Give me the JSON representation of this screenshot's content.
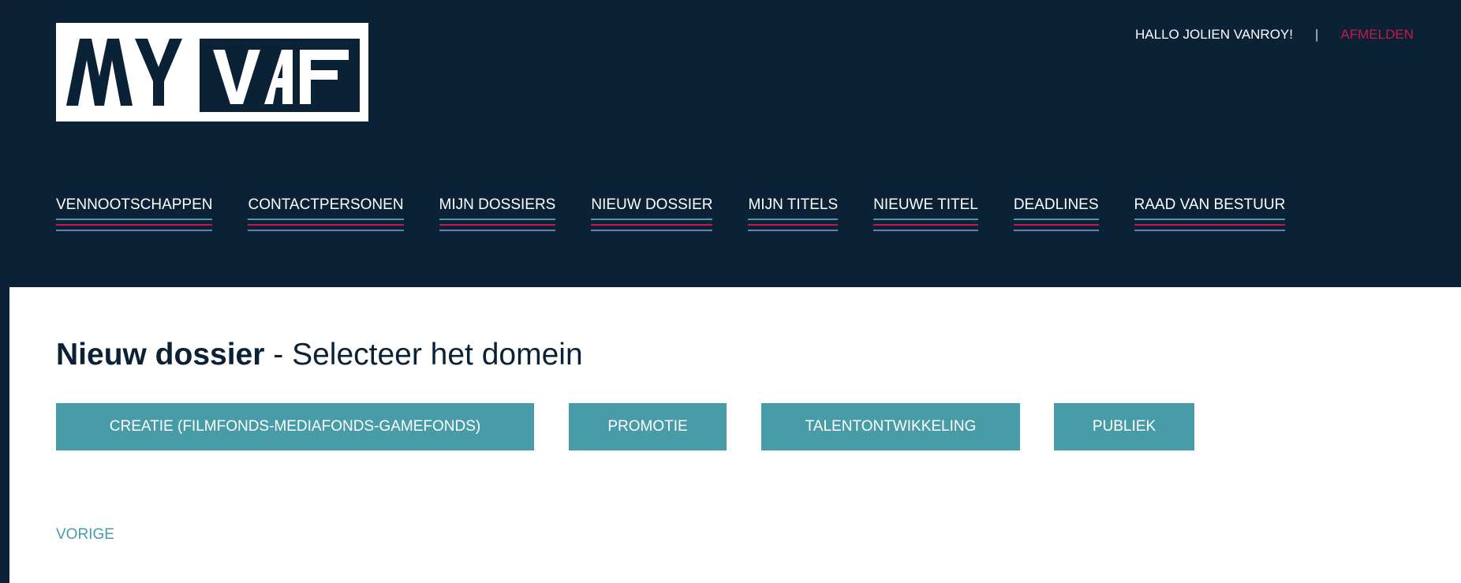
{
  "header": {
    "logo": {
      "text_left": "MY",
      "text_right": "VAF"
    },
    "user": {
      "greeting": "HALLO JOLIEN VANROY!",
      "separator": "|",
      "logout_label": "AFMELDEN"
    },
    "nav": {
      "items": [
        {
          "label": "VENNOOTSCHAPPEN"
        },
        {
          "label": "CONTACTPERSONEN"
        },
        {
          "label": "MIJN DOSSIERS"
        },
        {
          "label": "NIEUW DOSSIER"
        },
        {
          "label": "MIJN TITELS"
        },
        {
          "label": "NIEUWE TITEL"
        },
        {
          "label": "DEADLINES"
        },
        {
          "label": "RAAD VAN BESTUUR"
        }
      ]
    }
  },
  "main": {
    "title_bold": "Nieuw dossier",
    "title_rest": " - Selecteer het domein",
    "domains": [
      {
        "label": "CREATIE (FILMFONDS-MEDIAFONDS-GAMEFONDS)"
      },
      {
        "label": "PROMOTIE"
      },
      {
        "label": "TALENTONTWIKKELING"
      },
      {
        "label": "PUBLIEK"
      }
    ],
    "back_label": "VORIGE"
  },
  "colors": {
    "header_bg": "#0b2136",
    "accent_teal": "#479ca7",
    "accent_red": "#c8184b",
    "accent_purple": "#6c7fb4"
  }
}
